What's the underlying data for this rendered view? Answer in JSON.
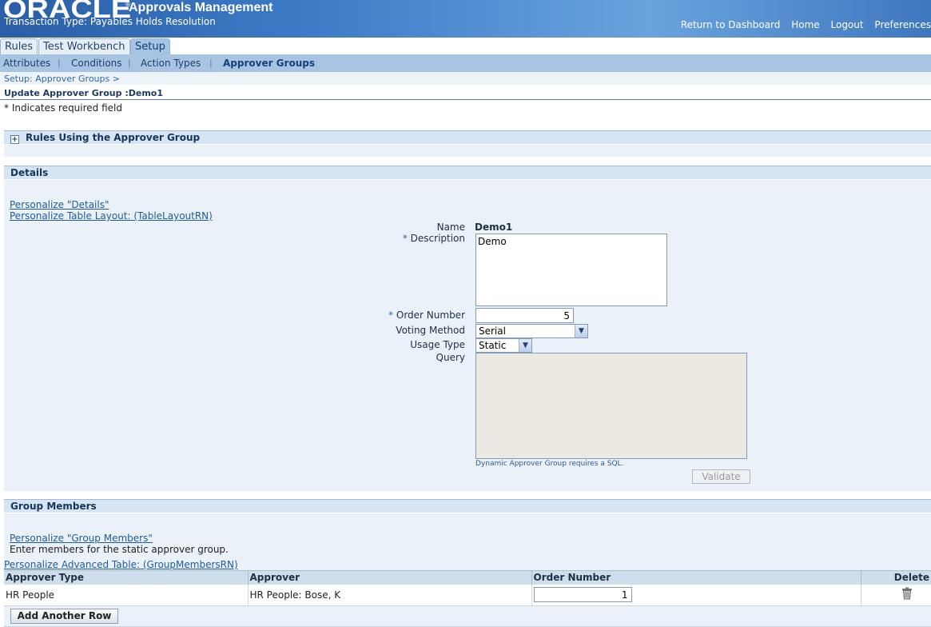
{
  "header": {
    "logo_text": "ORACLE",
    "registered_mark": "®",
    "app_title": "Approvals Management",
    "subtitle": "Transaction Type: Payables Holds Resolution",
    "global_links": [
      "Return to Dashboard",
      "Home",
      "Logout",
      "Preferences"
    ]
  },
  "tabs": [
    {
      "label": "Rules",
      "active": false
    },
    {
      "label": "Test Workbench",
      "active": false
    },
    {
      "label": "Setup",
      "active": true
    }
  ],
  "subtabs": [
    {
      "label": "Attributes",
      "active": false
    },
    {
      "label": "Conditions",
      "active": false
    },
    {
      "label": "Action Types",
      "active": false
    },
    {
      "label": "Approver Groups",
      "active": true
    }
  ],
  "breadcrumb": "Setup: Approver Groups  >",
  "page_title": "Update Approver Group :Demo1",
  "required_note": "* Indicates required field",
  "rules_section": {
    "title": "Rules Using the Approver Group",
    "expand_icon": "+"
  },
  "details": {
    "title": "Details",
    "personalize_links": [
      "Personalize \"Details\"",
      "Personalize Table Layout: (TableLayoutRN)"
    ],
    "name_label": "Name",
    "name_value": "Demo1",
    "required_marker": "*",
    "description_label": "Description",
    "description_value": "Demo",
    "order_number_label": "Order Number",
    "order_number_value": "5",
    "voting_method_label": "Voting Method",
    "voting_method_value": "Serial",
    "usage_type_label": "Usage Type",
    "usage_type_value": "Static",
    "query_label": "Query",
    "query_value": "",
    "query_hint": "Dynamic Approver Group requires a SQL.",
    "validate_label": "Validate",
    "dropdown_glyph": "▼"
  },
  "group_members": {
    "title": "Group Members",
    "personalize_link": "Personalize \"Group Members\"",
    "instructions": "Enter members for the static approver group.",
    "personalize_table_link": "Personalize Advanced Table: (GroupMembersRN)",
    "columns": [
      "Approver Type",
      "Approver",
      "Order Number",
      "Delete"
    ],
    "rows": [
      {
        "approver_type": "HR People",
        "approver": "HR People: Bose, K",
        "order_number": "1",
        "delete_icon": "trash-icon"
      }
    ],
    "add_row_label": "Add Another Row"
  },
  "colors": {
    "header_blue": "#3f7dc8",
    "subtab_bar": "#a8c4e3",
    "section_bar": "#d6e5f4",
    "panel_bg": "#eaf1f8",
    "link": "#205c9b"
  }
}
